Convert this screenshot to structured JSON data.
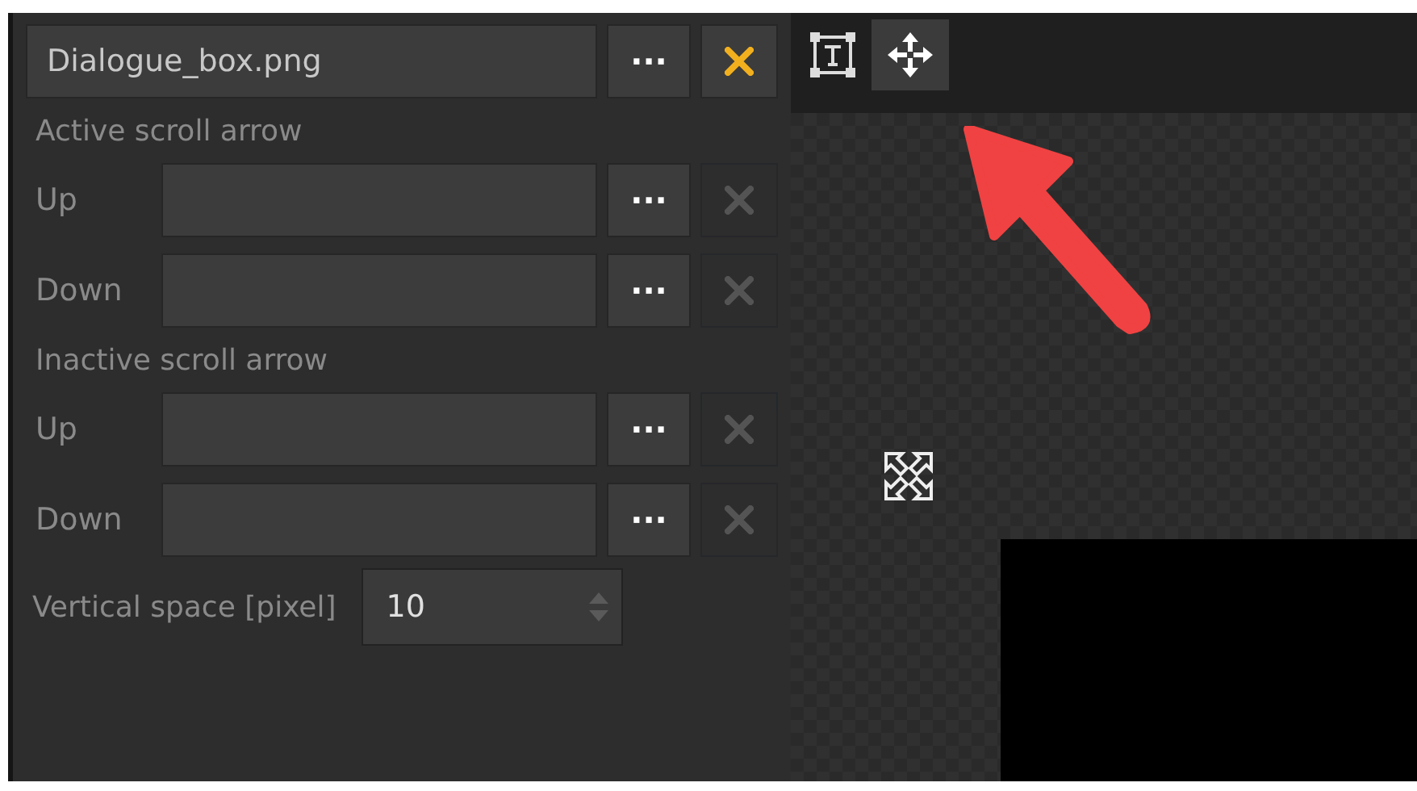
{
  "image_file": {
    "value": "Dialogue_box.png",
    "browse_label": "···",
    "clear_enabled": true
  },
  "sections": [
    {
      "title": "Active scroll arrow",
      "rows": [
        {
          "label": "Up",
          "value": "",
          "browse_label": "···",
          "clear_enabled": false
        },
        {
          "label": "Down",
          "value": "",
          "browse_label": "···",
          "clear_enabled": false
        }
      ]
    },
    {
      "title": "Inactive scroll arrow",
      "rows": [
        {
          "label": "Up",
          "value": "",
          "browse_label": "···",
          "clear_enabled": false
        },
        {
          "label": "Down",
          "value": "",
          "browse_label": "···",
          "clear_enabled": false
        }
      ]
    }
  ],
  "vertical_space": {
    "label": "Vertical space [pixel]",
    "value": "10"
  },
  "toolbar": [
    {
      "kind": "text",
      "selected": false
    },
    {
      "kind": "move",
      "selected": true
    }
  ]
}
